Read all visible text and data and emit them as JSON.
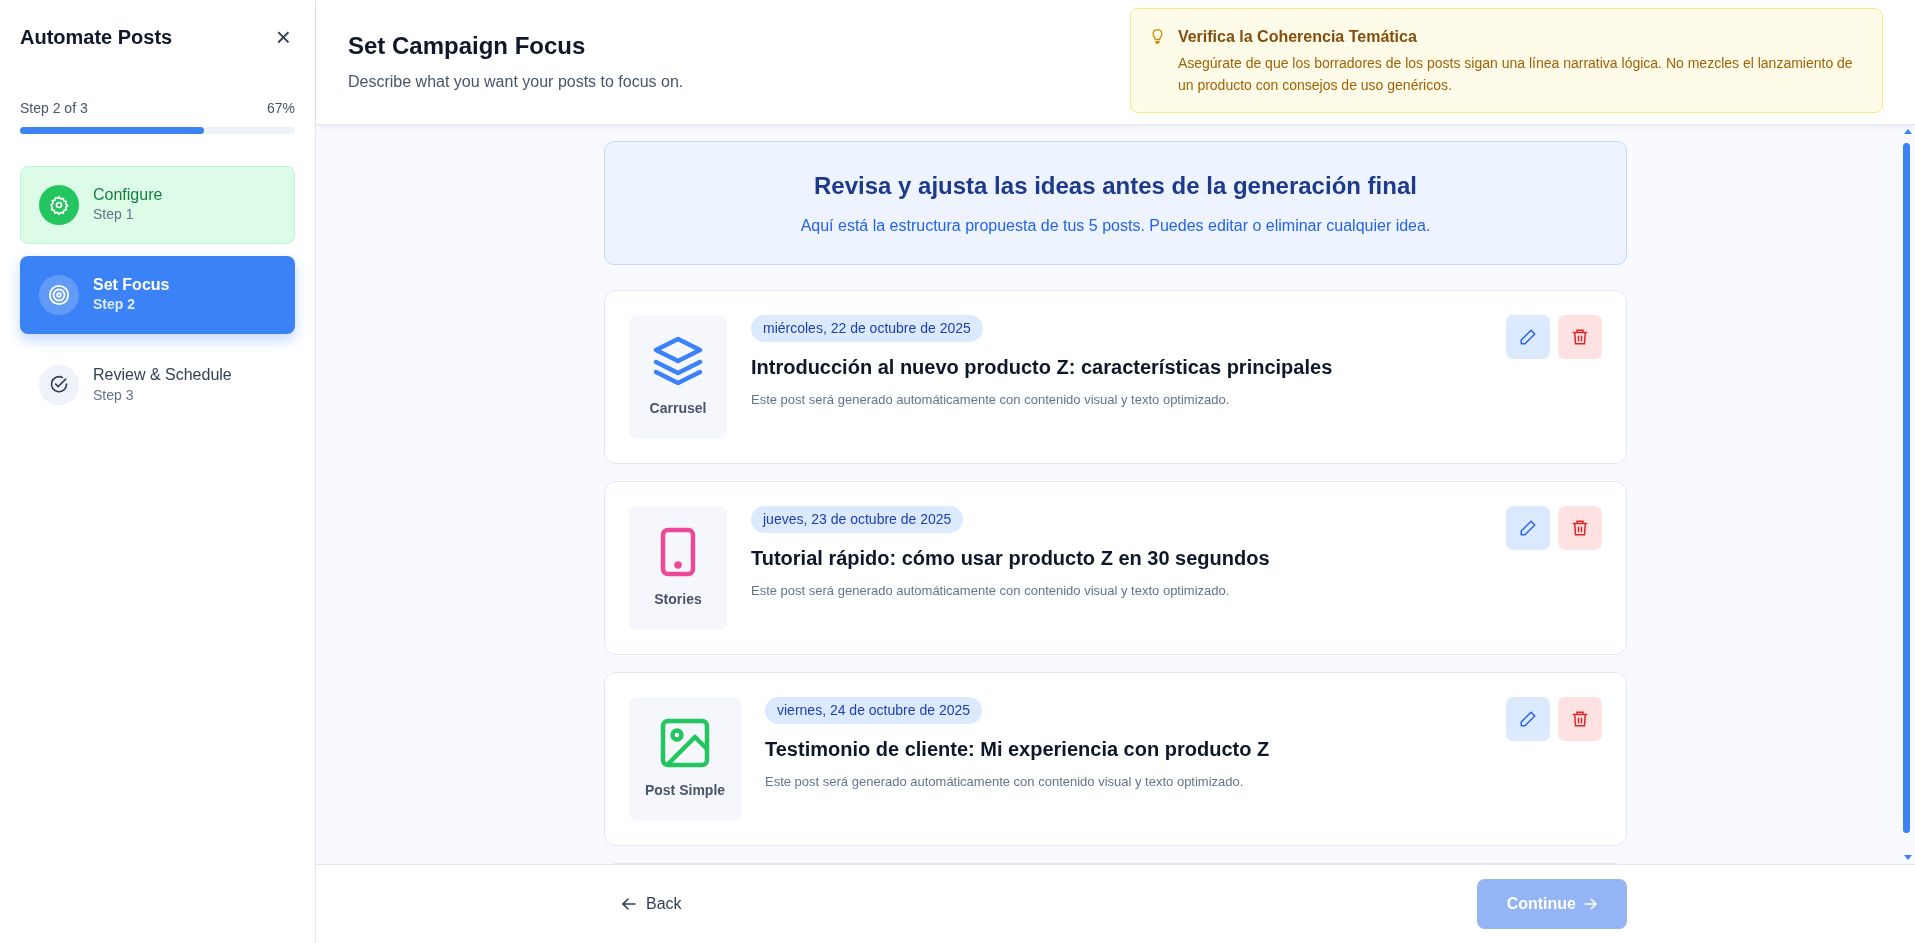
{
  "sidebar": {
    "title": "Automate Posts",
    "close": "×",
    "progress": {
      "label": "Step 2 of 3",
      "percent": "67%",
      "level": 0.67
    },
    "steps": [
      {
        "kind": "done",
        "selected": false,
        "label": "Configure",
        "sub": "Step 1"
      },
      {
        "kind": "active",
        "selected": true,
        "label": "Set Focus",
        "sub": "Step 2"
      },
      {
        "kind": "todo",
        "selected": false,
        "label": "Review & Schedule",
        "sub": "Step 3"
      }
    ]
  },
  "header": {
    "title": "Set Campaign Focus",
    "subtitle": "Describe what you want your posts to focus on."
  },
  "tip": {
    "title": "Verifica la Coherencia Temática",
    "text": "Asegúrate de que los borradores de los posts sigan una línea narrativa lógica. No mezcles el lanzamiento de un producto con consejos de uso genéricos."
  },
  "banner": {
    "title": "Revisa y ajusta las ideas antes de la generación final",
    "text": "Aquí está la estructura propuesta de tus 5 posts. Puedes editar o eliminar cualquier idea."
  },
  "posts": [
    {
      "kind": "carousel",
      "color": "#3b82f6",
      "type_label": "Carrusel",
      "date": "miércoles, 22 de octubre de 2025",
      "title": "Introducción al nuevo producto Z: características principales",
      "text": "Este post será generado automáticamente con contenido visual y texto optimizado."
    },
    {
      "kind": "stories",
      "color": "#ec4899",
      "type_label": "Stories",
      "date": "jueves, 23 de octubre de 2025",
      "title": "Tutorial rápido: cómo usar producto Z en 30 segundos",
      "text": "Este post será generado automáticamente con contenido visual y texto optimizado."
    },
    {
      "kind": "image",
      "color": "#22c55e",
      "type_label": "Post Simple",
      "date": "viernes, 24 de octubre de 2025",
      "title": "Testimonio de cliente: Mi experiencia con producto Z",
      "text": "Este post será generado automáticamente con contenido visual y texto optimizado."
    }
  ],
  "footer": {
    "back": "Back",
    "continue": "Continue",
    "continue_disabled": true
  }
}
